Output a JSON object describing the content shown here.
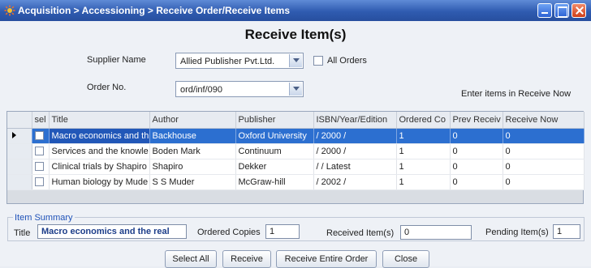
{
  "window": {
    "title": "Acquisition > Accessioning > Receive Order/Receive Items"
  },
  "heading": "Receive Item(s)",
  "form": {
    "supplier_label": "Supplier Name",
    "supplier_value": "Allied Publisher Pvt.Ltd.",
    "all_orders_label": "All Orders",
    "order_label": "Order No.",
    "order_value": "ord/inf/090",
    "hint": "Enter items in Receive Now"
  },
  "grid": {
    "columns": [
      "sel",
      "Title",
      "Author",
      "Publisher",
      "ISBN/Year/Edition",
      "Ordered Co",
      "Prev Receiv",
      "Receive Now"
    ],
    "rows": [
      {
        "title": "Macro economics and th",
        "author": "Backhouse",
        "publisher": "Oxford University",
        "isbn": "/ 2000 /",
        "ordered": "1",
        "prev": "0",
        "now": "0"
      },
      {
        "title": "Services and the knowle",
        "author": "Boden Mark",
        "publisher": "Continuum",
        "isbn": "/ 2000 /",
        "ordered": "1",
        "prev": "0",
        "now": "0"
      },
      {
        "title": "Clinical trials by Shapiro",
        "author": "Shapiro",
        "publisher": "Dekker",
        "isbn": "/ / Latest",
        "ordered": "1",
        "prev": "0",
        "now": "0"
      },
      {
        "title": "Human biology by Mude",
        "author": "S S Muder",
        "publisher": "McGraw-hill",
        "isbn": "/ 2002 /",
        "ordered": "1",
        "prev": "0",
        "now": "0"
      }
    ]
  },
  "summary": {
    "legend": "Item Summary",
    "title_label": "Title",
    "title_value": "Macro economics and the real",
    "ordered_label": "Ordered Copies",
    "ordered_value": "1",
    "received_label": "Received Item(s)",
    "received_value": "0",
    "pending_label": "Pending Item(s)",
    "pending_value": "1"
  },
  "buttons": {
    "select_all": "Select All",
    "receive": "Receive",
    "receive_entire": "Receive Entire Order",
    "close": "Close"
  },
  "colors": {
    "titlebar": "#2f5bb0",
    "selection": "#2c6fd0",
    "legend": "#1f52b8"
  }
}
